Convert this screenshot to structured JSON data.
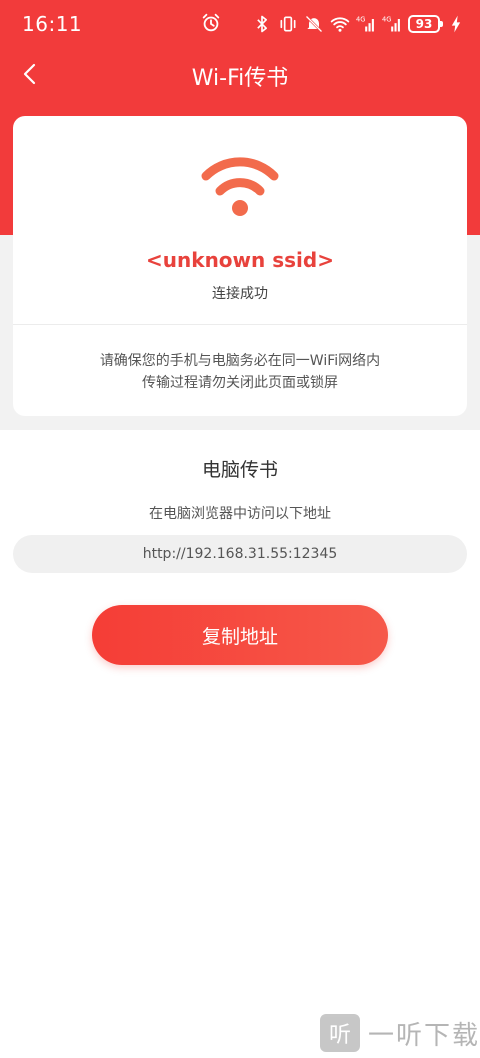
{
  "status_bar": {
    "time": "16:11",
    "battery": "93",
    "icons": [
      "alarm-icon",
      "bluetooth-icon",
      "vibrate-icon",
      "mute-icon",
      "wifi-icon",
      "signal-4g-icon",
      "signal-4g-icon",
      "battery-icon",
      "charging-icon"
    ]
  },
  "header": {
    "title": "Wi-Fi传书",
    "back_icon": "chevron-left-icon"
  },
  "card": {
    "wifi_icon": "wifi-icon",
    "ssid": "<unknown ssid>",
    "status": "连接成功",
    "tip_line1": "请确保您的手机与电脑务必在同一WiFi网络内",
    "tip_line2": "传输过程请勿关闭此页面或锁屏"
  },
  "transfer": {
    "title": "电脑传书",
    "subtitle": "在电脑浏览器中访问以下地址",
    "address": "http://192.168.31.55:12345",
    "copy_label": "复制地址"
  },
  "watermark": {
    "badge": "听",
    "text": "一听下载"
  },
  "colors": {
    "header_red": "#f23b3b",
    "accent_red": "#e8423c",
    "wifi_icon": "#f26b4c",
    "button_start": "#f53d36",
    "button_end": "#f6594a",
    "band_grey": "#f2f2f2"
  }
}
